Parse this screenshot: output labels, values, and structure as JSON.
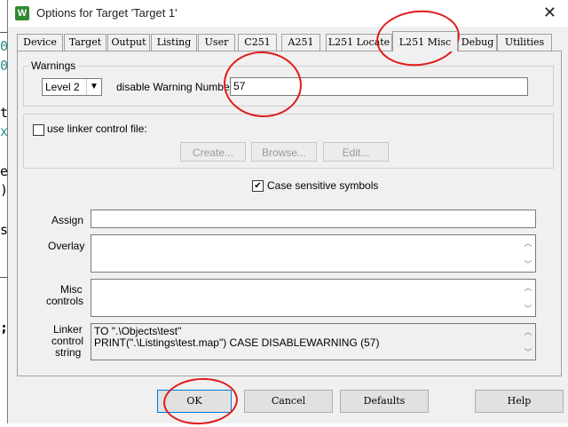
{
  "background_editor": {
    "glyphs": [
      "0",
      "0",
      "t",
      "x",
      "e",
      ")",
      "s",
      ";"
    ]
  },
  "titlebar": {
    "icon_letter": "W",
    "title": "Options for Target 'Target 1'",
    "close_glyph": "✕"
  },
  "tabs": [
    {
      "label": "Device"
    },
    {
      "label": "Target"
    },
    {
      "label": "Output"
    },
    {
      "label": "Listing"
    },
    {
      "label": "User"
    },
    {
      "label": "C251"
    },
    {
      "label": "A251"
    },
    {
      "label": "L251 Locate"
    },
    {
      "label": "L251 Misc"
    },
    {
      "label": "Debug"
    },
    {
      "label": "Utilities"
    }
  ],
  "active_tab": "L251 Misc",
  "warnings": {
    "group_label": "Warnings",
    "level_value": "Level 2",
    "disable_label": "disable Warning Numbers:",
    "disable_value": "57"
  },
  "linker_file": {
    "checkbox_label": "use linker control file:",
    "checked": false,
    "create_label": "Create...",
    "browse_label": "Browse...",
    "edit_label": "Edit..."
  },
  "case_sensitive": {
    "label": "Case sensitive symbols",
    "checked": true,
    "check_glyph": "✔"
  },
  "assign": {
    "label": "Assign",
    "value": ""
  },
  "overlay": {
    "label": "Overlay",
    "value": ""
  },
  "misc": {
    "label_line1": "Misc",
    "label_line2": "controls",
    "value": ""
  },
  "linker_string": {
    "label_line1": "Linker",
    "label_line2": "control",
    "label_line3": "string",
    "line1": "TO \".\\Objects\\test\"",
    "line2": "PRINT(\".\\Listings\\test.map\") CASE DISABLEWARNING (57)"
  },
  "buttons": {
    "ok": "OK",
    "cancel": "Cancel",
    "defaults": "Defaults",
    "help": "Help"
  },
  "icons": {
    "dropdown_arrow": "▼",
    "scroll_up": "︿",
    "scroll_down": "﹀"
  },
  "colors": {
    "annotation_red": "#e01b1b",
    "dialog_bg": "#f0f0f0",
    "default_button_border": "#0078d7"
  }
}
